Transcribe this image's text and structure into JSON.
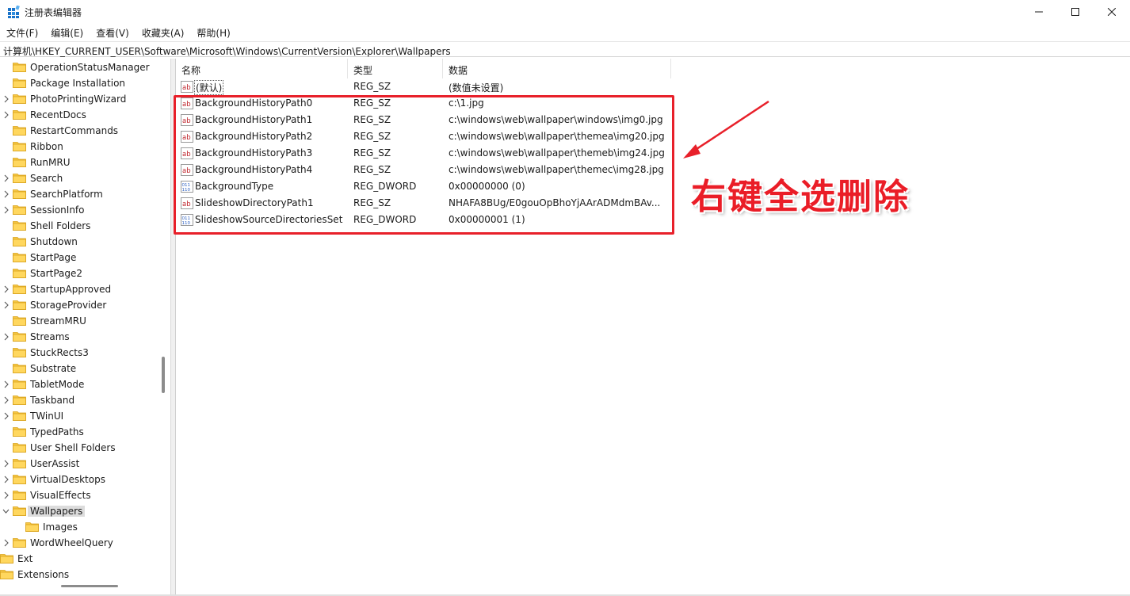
{
  "window": {
    "title": "注册表编辑器"
  },
  "menu": [
    "文件(F)",
    "编辑(E)",
    "查看(V)",
    "收藏夹(A)",
    "帮助(H)"
  ],
  "address": "计算机\\HKEY_CURRENT_USER\\Software\\Microsoft\\Windows\\CurrentVersion\\Explorer\\Wallpapers",
  "tree": [
    {
      "label": "OperationStatusManager",
      "chevron": false
    },
    {
      "label": "Package Installation",
      "chevron": false
    },
    {
      "label": "PhotoPrintingWizard",
      "chevron": true
    },
    {
      "label": "RecentDocs",
      "chevron": true
    },
    {
      "label": "RestartCommands",
      "chevron": false
    },
    {
      "label": "Ribbon",
      "chevron": false
    },
    {
      "label": "RunMRU",
      "chevron": false
    },
    {
      "label": "Search",
      "chevron": true
    },
    {
      "label": "SearchPlatform",
      "chevron": true
    },
    {
      "label": "SessionInfo",
      "chevron": true
    },
    {
      "label": "Shell Folders",
      "chevron": false
    },
    {
      "label": "Shutdown",
      "chevron": false
    },
    {
      "label": "StartPage",
      "chevron": false
    },
    {
      "label": "StartPage2",
      "chevron": false
    },
    {
      "label": "StartupApproved",
      "chevron": true
    },
    {
      "label": "StorageProvider",
      "chevron": true
    },
    {
      "label": "StreamMRU",
      "chevron": false
    },
    {
      "label": "Streams",
      "chevron": true
    },
    {
      "label": "StuckRects3",
      "chevron": false
    },
    {
      "label": "Substrate",
      "chevron": false
    },
    {
      "label": "TabletMode",
      "chevron": true
    },
    {
      "label": "Taskband",
      "chevron": true
    },
    {
      "label": "TWinUI",
      "chevron": true
    },
    {
      "label": "TypedPaths",
      "chevron": false
    },
    {
      "label": "User Shell Folders",
      "chevron": false
    },
    {
      "label": "UserAssist",
      "chevron": true
    },
    {
      "label": "VirtualDesktops",
      "chevron": true
    },
    {
      "label": "VisualEffects",
      "chevron": true
    },
    {
      "label": "Wallpapers",
      "chevron": true,
      "expanded": true,
      "selected": true
    },
    {
      "label": "Images",
      "chevron": false,
      "child": true
    },
    {
      "label": "WordWheelQuery",
      "chevron": true
    },
    {
      "label": "Ext",
      "chevron": true,
      "root": true
    },
    {
      "label": "Extensions",
      "chevron": false,
      "root": true
    }
  ],
  "columns": {
    "name": "名称",
    "type": "类型",
    "data": "数据"
  },
  "values": [
    {
      "name": "(默认)",
      "type": "REG_SZ",
      "data": "(数值未设置)",
      "icon": "string"
    },
    {
      "name": "BackgroundHistoryPath0",
      "type": "REG_SZ",
      "data": "c:\\1.jpg",
      "icon": "string"
    },
    {
      "name": "BackgroundHistoryPath1",
      "type": "REG_SZ",
      "data": "c:\\windows\\web\\wallpaper\\windows\\img0.jpg",
      "icon": "string"
    },
    {
      "name": "BackgroundHistoryPath2",
      "type": "REG_SZ",
      "data": "c:\\windows\\web\\wallpaper\\themea\\img20.jpg",
      "icon": "string"
    },
    {
      "name": "BackgroundHistoryPath3",
      "type": "REG_SZ",
      "data": "c:\\windows\\web\\wallpaper\\themeb\\img24.jpg",
      "icon": "string"
    },
    {
      "name": "BackgroundHistoryPath4",
      "type": "REG_SZ",
      "data": "c:\\windows\\web\\wallpaper\\themec\\img28.jpg",
      "icon": "string"
    },
    {
      "name": "BackgroundType",
      "type": "REG_DWORD",
      "data": "0x00000000 (0)",
      "icon": "binary"
    },
    {
      "name": "SlideshowDirectoryPath1",
      "type": "REG_SZ",
      "data": "NHAFA8BUg/E0gouOpBhoYjAArADMdmBAv...",
      "icon": "string"
    },
    {
      "name": "SlideshowSourceDirectoriesSet",
      "type": "REG_DWORD",
      "data": "0x00000001 (1)",
      "icon": "binary"
    }
  ],
  "annotation": {
    "text": "右键全选删除",
    "color": "#e8202a"
  }
}
